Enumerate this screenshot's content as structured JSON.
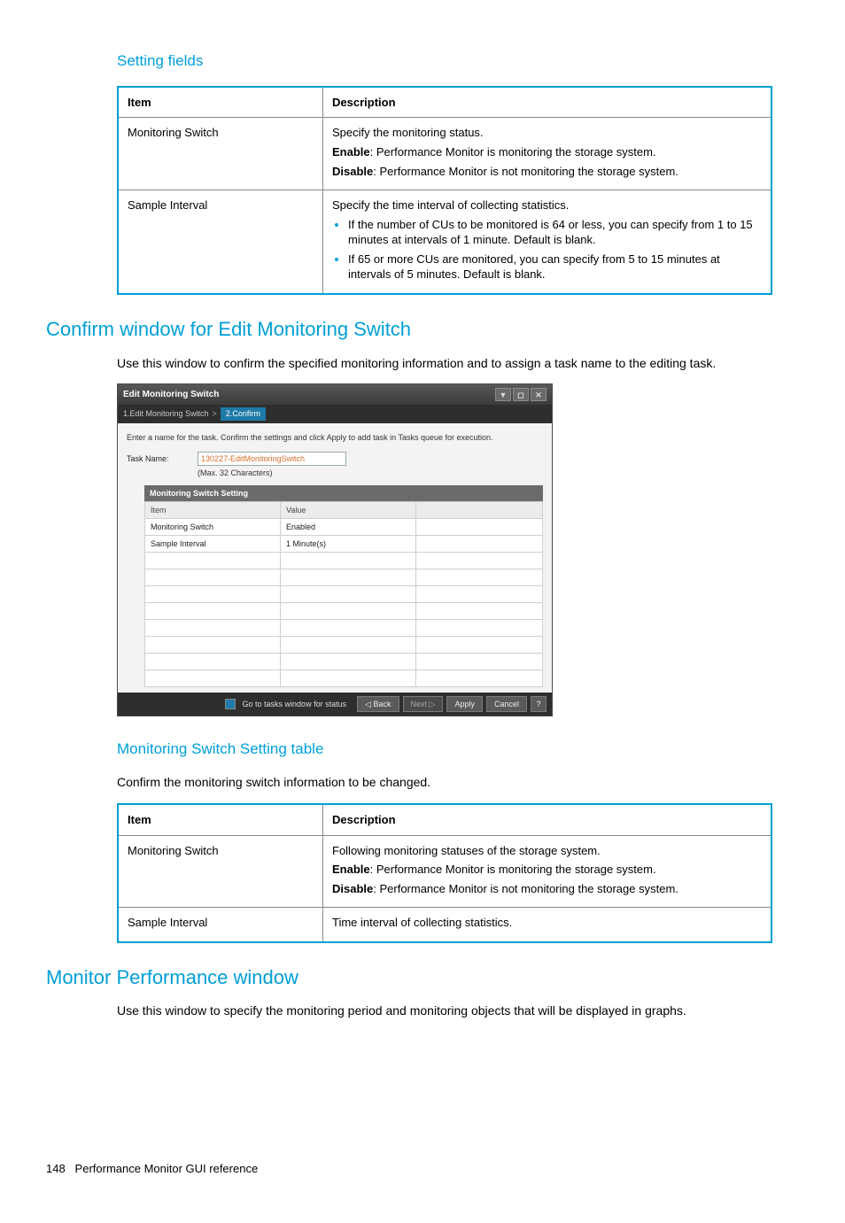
{
  "section1": {
    "heading": "Setting fields",
    "table": {
      "headers": [
        "Item",
        "Description"
      ],
      "rows": [
        {
          "item": "Monitoring Switch",
          "lines": [
            "Specify the monitoring status."
          ],
          "enable_label": "Enable",
          "enable_text": ": Performance Monitor is monitoring the storage system.",
          "disable_label": "Disable",
          "disable_text": ": Performance Monitor is not monitoring the storage system."
        },
        {
          "item": "Sample Interval",
          "lines": [
            "Specify the time interval of collecting statistics."
          ],
          "bullets": [
            "If the number of CUs to be monitored is 64 or less, you can specify from 1 to 15 minutes at intervals of 1 minute. Default is blank.",
            "If 65 or more CUs are monitored, you can specify from 5 to 15 minutes at intervals of 5 minutes. Default is blank."
          ]
        }
      ]
    }
  },
  "section2": {
    "heading": "Confirm window for Edit Monitoring Switch",
    "body": "Use this window to confirm the specified monitoring information and to assign a task name to the editing task."
  },
  "dialog": {
    "title": "Edit Monitoring Switch",
    "step1": "1.Edit Monitoring Switch",
    "step2": "2.Confirm",
    "instruction": "Enter a name for the task. Confirm the settings and click Apply to add task in Tasks queue for execution.",
    "task_label": "Task Name:",
    "task_value": "130227-EditMonitoringSwitch",
    "task_hint": "(Max. 32 Characters)",
    "panel_title": "Monitoring Switch Setting",
    "table_headers": [
      "Item",
      "Value"
    ],
    "rows": [
      {
        "item": "Monitoring Switch",
        "value": "Enabled"
      },
      {
        "item": "Sample Interval",
        "value": "1 Minute(s)"
      }
    ],
    "footer_check_label": "Go to tasks window for status",
    "buttons": {
      "back": "◁ Back",
      "next": "Next ▷",
      "apply": "Apply",
      "cancel": "Cancel",
      "help": "?"
    },
    "window_controls": {
      "filter": "▼",
      "restore": "◻",
      "close": "✕"
    }
  },
  "section3": {
    "heading": "Monitoring Switch Setting table",
    "body": "Confirm the monitoring switch information to be changed.",
    "table": {
      "headers": [
        "Item",
        "Description"
      ],
      "rows": [
        {
          "item": "Monitoring Switch",
          "lines": [
            "Following monitoring statuses of the storage system."
          ],
          "enable_label": "Enable",
          "enable_text": ": Performance Monitor is monitoring the storage system.",
          "disable_label": "Disable",
          "disable_text": ": Performance Monitor is not monitoring the storage system."
        },
        {
          "item": "Sample Interval",
          "lines": [
            "Time interval of collecting statistics."
          ]
        }
      ]
    }
  },
  "section4": {
    "heading": "Monitor Performance window",
    "body": "Use this window to specify the monitoring period and monitoring objects that will be displayed in graphs."
  },
  "footer": {
    "page_number": "148",
    "chapter": "Performance Monitor GUI reference"
  }
}
